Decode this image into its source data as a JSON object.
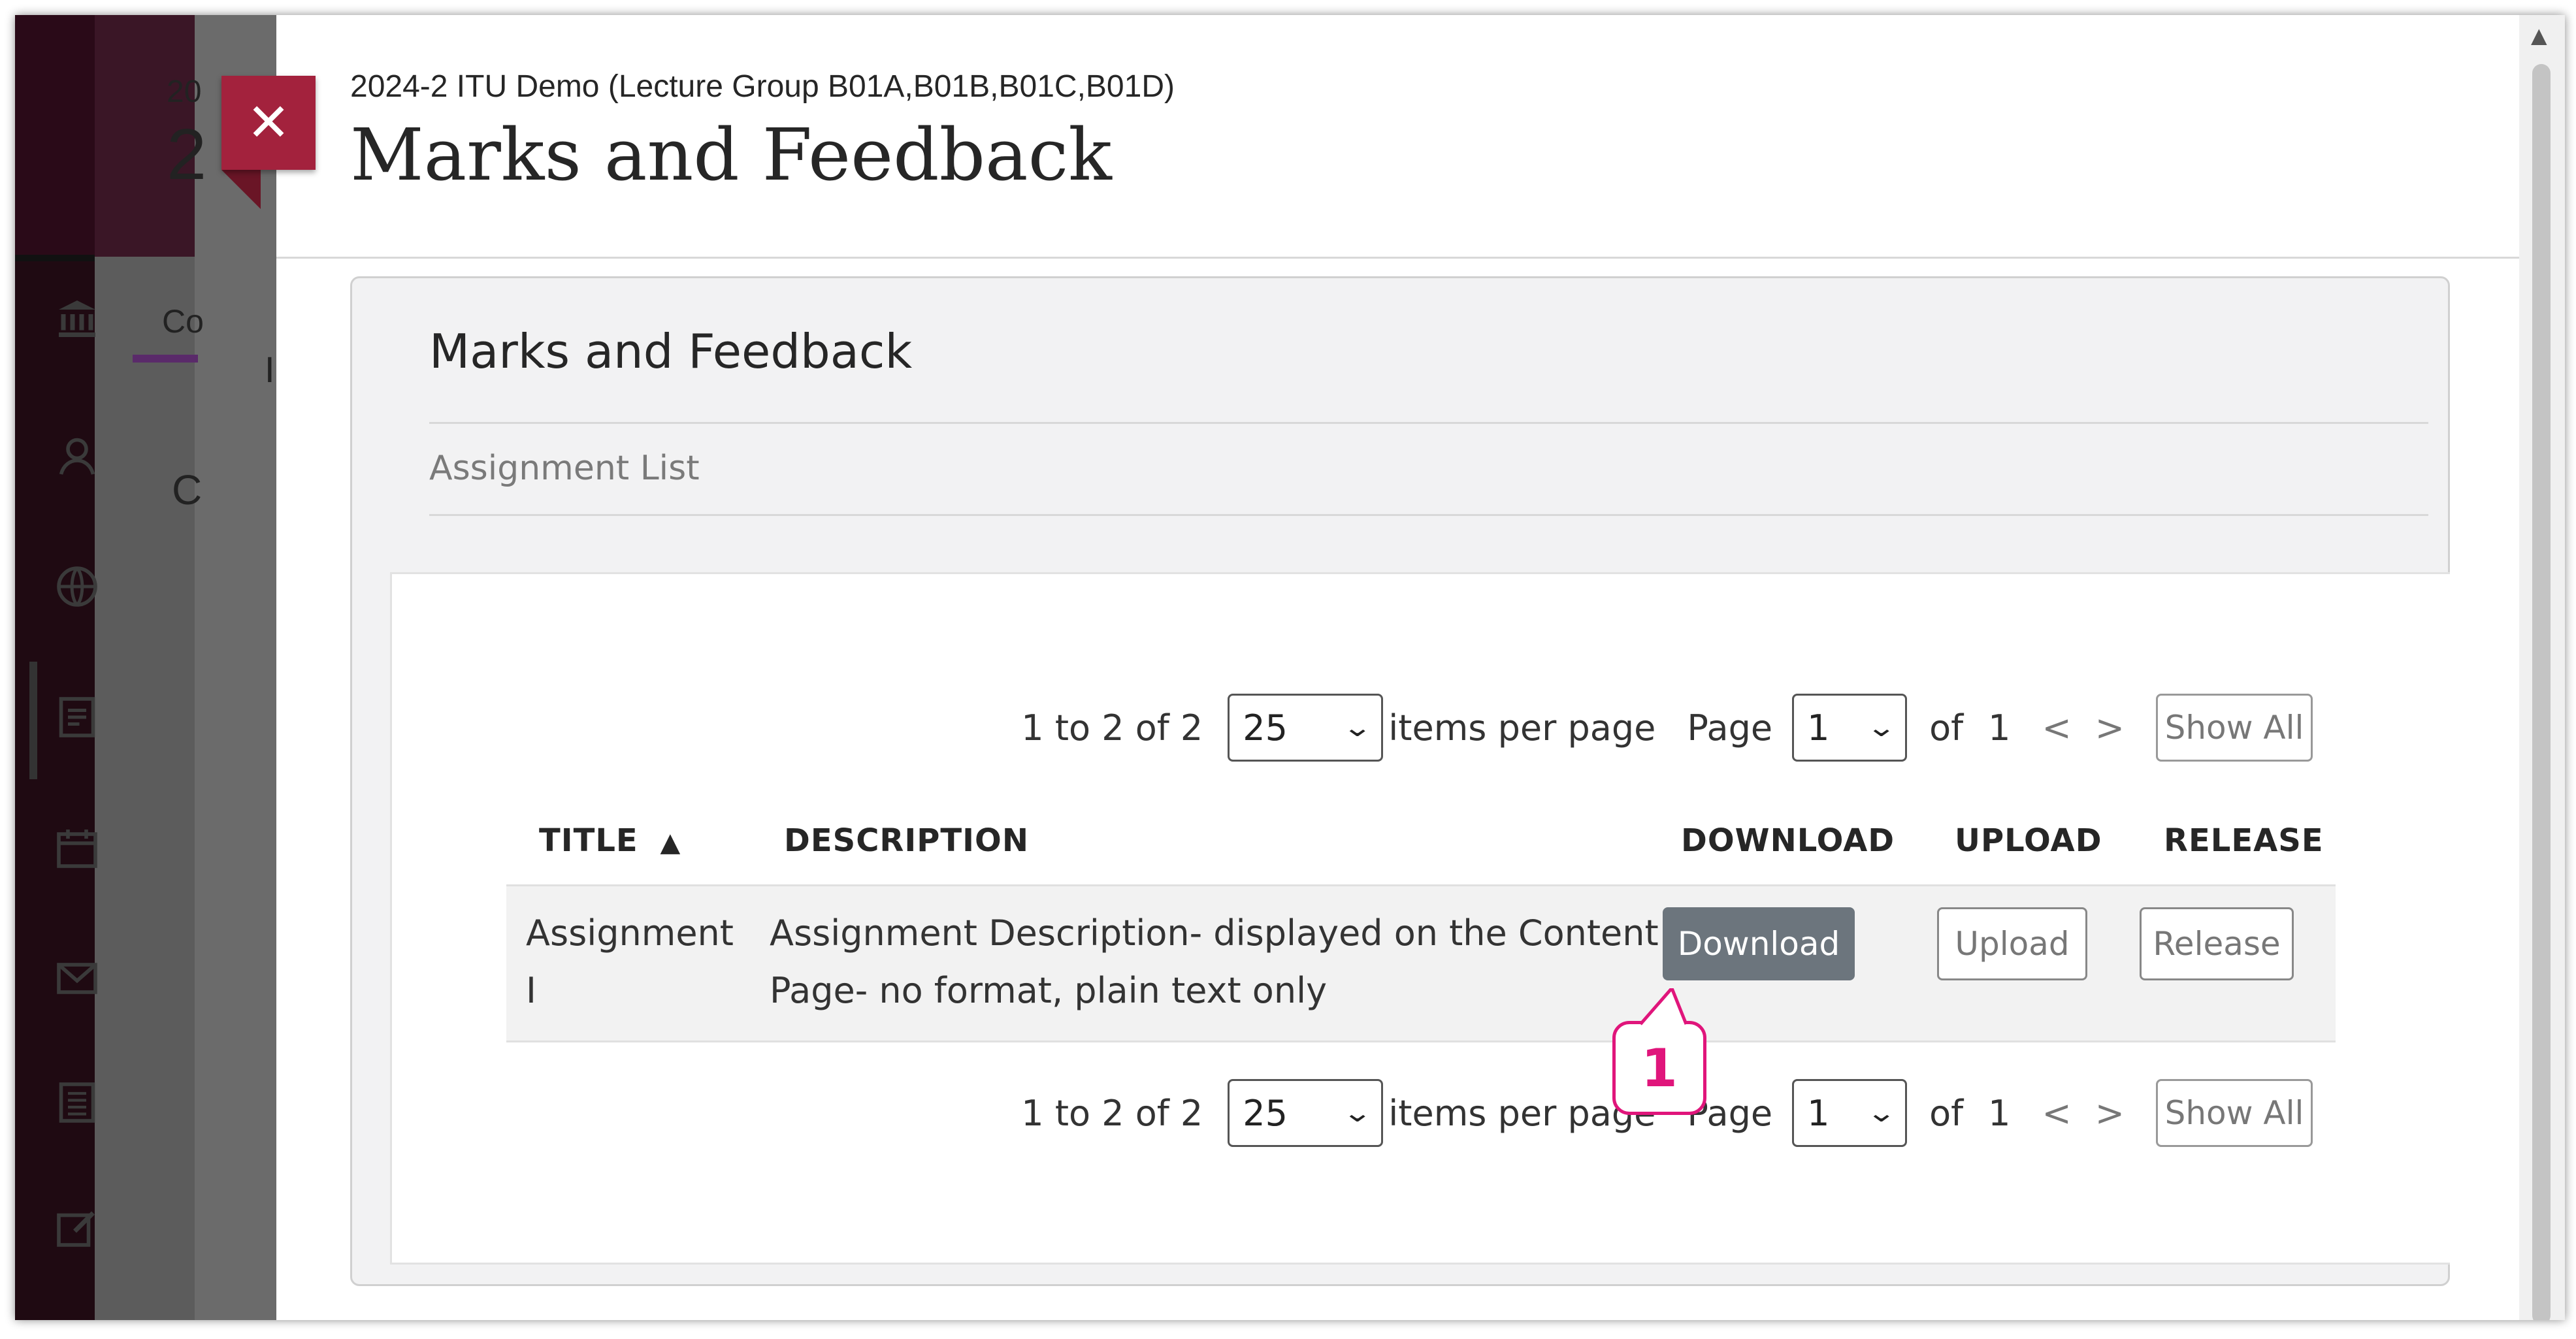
{
  "background_app": {
    "fragments": [
      "20",
      "2",
      "Co",
      "I",
      "C"
    ],
    "rail_icons": [
      "institution-icon",
      "person-icon",
      "globe-icon",
      "calendar-icon",
      "mail-icon",
      "document-icon",
      "edit-icon"
    ]
  },
  "modal": {
    "close_label": "✕",
    "course_name": "2024-2 ITU Demo (Lecture Group B01A,B01B,B01C,B01D)",
    "title": "Marks and Feedback"
  },
  "card": {
    "title": "Marks and Feedback",
    "breadcrumb": "Assignment List"
  },
  "pager": {
    "range_text": "1 to 2 of 2",
    "per_page_value": "25",
    "per_page_label": "items per page",
    "page_label": "Page",
    "page_value": "1",
    "of_label": "of",
    "total_pages": "1",
    "prev": "<",
    "next": ">",
    "show_all": "Show All"
  },
  "table": {
    "headers": {
      "title": "TITLE",
      "sort_indicator": "▲",
      "description": "DESCRIPTION",
      "download": "DOWNLOAD",
      "upload": "UPLOAD",
      "release": "RELEASE"
    },
    "rows": [
      {
        "title_line1": "Assignment",
        "title_line2": "I",
        "description_line1": "Assignment Description- displayed on the Content",
        "description_line2": "Page- no format, plain text only",
        "download_label": "Download",
        "upload_label": "Upload",
        "release_label": "Release"
      }
    ]
  },
  "callout": {
    "number": "1",
    "color": "#e0157b"
  },
  "colors": {
    "close": "#a3223d",
    "download_button": "#6c757d"
  }
}
